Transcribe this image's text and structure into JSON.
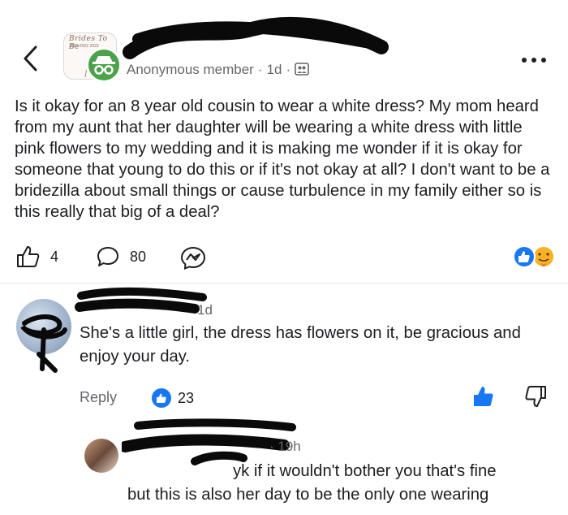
{
  "header": {
    "group_logo_title": "Brides To Be",
    "group_logo_years": "2020·2022·2023",
    "author_label": "Anonymous member",
    "time": "1d",
    "privacy_icon": "members-icon",
    "more_icon": "more-dots-icon"
  },
  "post": {
    "body": "Is it okay for an 8 year old cousin to wear a white dress? My mom heard from my aunt that her daughter will be wearing a white dress with little pink flowers to my wedding and it is making me wonder if it is okay for someone that young to do this or if it's not okay at all? I don't want to be a bridezilla about small things or cause turbulence in my family either so is this really that big of a deal?",
    "like_count": "4",
    "comment_count": "80",
    "accent_color": "#1877f2"
  },
  "comments": [
    {
      "time": "1d",
      "text": "She's a little girl, the dress has flowers on it, be gracious and enjoy your day.",
      "reply_label": "Reply",
      "like_count": "23"
    },
    {
      "time": "· 19h",
      "text_line1": "yk if it wouldn't bother you that's fine",
      "text_line2": "but this is also her day to be the only one wearing"
    }
  ]
}
